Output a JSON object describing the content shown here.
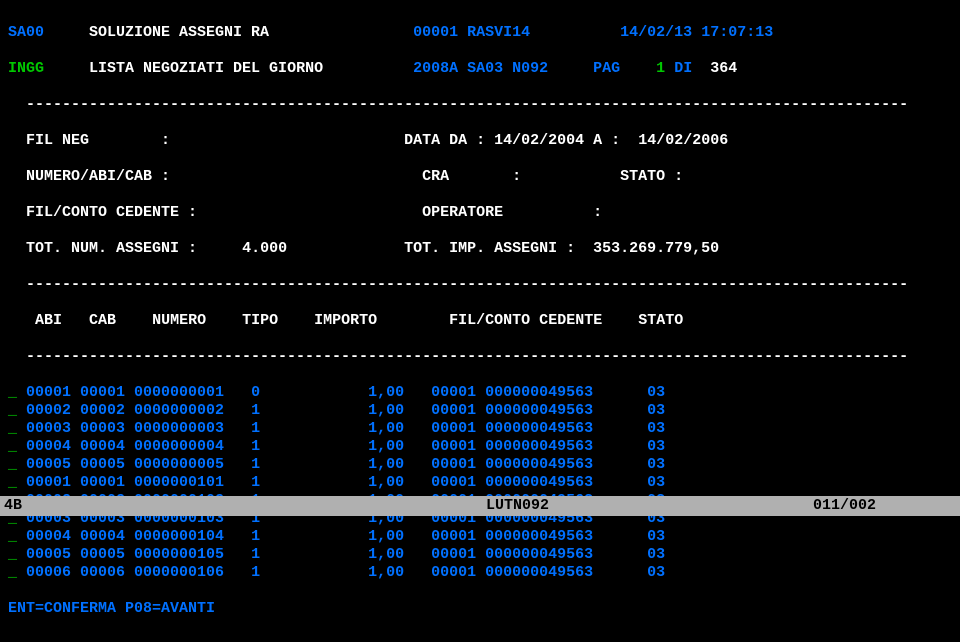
{
  "header": {
    "code1": "SA00",
    "title1": "SOLUZIONE ASSEGNI RA",
    "code2": "00001",
    "prog": "RASVI14",
    "date": "14/02/13",
    "time": "17:07:13",
    "code3": "INGG",
    "title2": "LISTA NEGOZIATI DEL GIORNO",
    "code4": "2008A SA03 N092",
    "pag_label": "PAG",
    "pag_num": "1",
    "di": "DI",
    "pag_total": "364"
  },
  "filters": {
    "fil_neg_label": "FIL NEG",
    "data_da_label": "DATA DA :",
    "data_da": "14/02/2004",
    "a_label": "A :",
    "data_a": "14/02/2006",
    "numero_abi_cab_label": "NUMERO/ABI/CAB :",
    "cra_label": "CRA",
    "stato_label": "STATO :",
    "fil_conto_cedente_label": "FIL/CONTO CEDENTE :",
    "operatore_label": "OPERATORE",
    "tot_num_assegni_label": "TOT. NUM. ASSEGNI :",
    "tot_num_assegni": "4.000",
    "tot_imp_assegni_label": "TOT. IMP. ASSEGNI :",
    "tot_imp_assegni": "353.269.779,50"
  },
  "columns": {
    "abi": "ABI",
    "cab": "CAB",
    "numero": "NUMERO",
    "tipo": "TIPO",
    "importo": "IMPORTO",
    "fil_conto": "FIL/CONTO CEDENTE",
    "stato": "STATO"
  },
  "rows": [
    {
      "abi": "00001",
      "cab": "00001",
      "numero": "0000000001",
      "tipo": "0",
      "importo": "1,00",
      "fil": "00001",
      "conto": "000000049563",
      "stato": "03"
    },
    {
      "abi": "00002",
      "cab": "00002",
      "numero": "0000000002",
      "tipo": "1",
      "importo": "1,00",
      "fil": "00001",
      "conto": "000000049563",
      "stato": "03"
    },
    {
      "abi": "00003",
      "cab": "00003",
      "numero": "0000000003",
      "tipo": "1",
      "importo": "1,00",
      "fil": "00001",
      "conto": "000000049563",
      "stato": "03"
    },
    {
      "abi": "00004",
      "cab": "00004",
      "numero": "0000000004",
      "tipo": "1",
      "importo": "1,00",
      "fil": "00001",
      "conto": "000000049563",
      "stato": "03"
    },
    {
      "abi": "00005",
      "cab": "00005",
      "numero": "0000000005",
      "tipo": "1",
      "importo": "1,00",
      "fil": "00001",
      "conto": "000000049563",
      "stato": "03"
    },
    {
      "abi": "00001",
      "cab": "00001",
      "numero": "0000000101",
      "tipo": "1",
      "importo": "1,00",
      "fil": "00001",
      "conto": "000000049563",
      "stato": "03"
    },
    {
      "abi": "00002",
      "cab": "00002",
      "numero": "0000000102",
      "tipo": "1",
      "importo": "1,00",
      "fil": "00001",
      "conto": "000000049563",
      "stato": "03"
    },
    {
      "abi": "00003",
      "cab": "00003",
      "numero": "0000000103",
      "tipo": "1",
      "importo": "1,00",
      "fil": "00001",
      "conto": "000000049563",
      "stato": "03"
    },
    {
      "abi": "00004",
      "cab": "00004",
      "numero": "0000000104",
      "tipo": "1",
      "importo": "1,00",
      "fil": "00001",
      "conto": "000000049563",
      "stato": "03"
    },
    {
      "abi": "00005",
      "cab": "00005",
      "numero": "0000000105",
      "tipo": "1",
      "importo": "1,00",
      "fil": "00001",
      "conto": "000000049563",
      "stato": "03"
    },
    {
      "abi": "00006",
      "cab": "00006",
      "numero": "0000000106",
      "tipo": "1",
      "importo": "1,00",
      "fil": "00001",
      "conto": "000000049563",
      "stato": "03"
    }
  ],
  "footer": {
    "ent": "ENT=CONFERMA P08=AVANTI"
  },
  "status": {
    "left": "4B",
    "mid": "LUTN092",
    "right": "011/002"
  },
  "dashes": "  --------------------------------------------------------------------------------------------------"
}
